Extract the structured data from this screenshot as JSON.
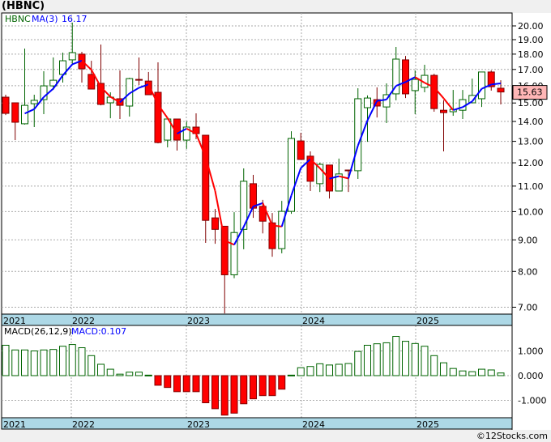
{
  "header": {
    "title": "(HBNC)"
  },
  "footer": {
    "copyright": "©12Stocks.com"
  },
  "colors": {
    "up": "#006400",
    "down": "#ff0000",
    "down_border": "#800000",
    "ma_up": "#0000ff",
    "ma_down": "#ff0000",
    "axis_band": "#add8e6",
    "last_price_bg": "#ffb6b6"
  },
  "chart_data": [
    {
      "type": "candlestick",
      "symbol_label": "HBNC",
      "indicator_label": "MA(3)",
      "indicator_value": "16.17",
      "last_price": "15.63",
      "scale": "log",
      "ylim": [
        6.8,
        20.6
      ],
      "y_ticks": [
        "20.00",
        "19.00",
        "18.00",
        "17.00",
        "16.00",
        "15.00",
        "14.00",
        "13.00",
        "12.00",
        "11.00",
        "10.00",
        "9.00",
        "8.00",
        "7.00"
      ],
      "x_ticks": [
        "2021",
        "2022",
        "2023",
        "2024",
        "2025"
      ],
      "grid": true,
      "period": "monthly",
      "ohlc": [
        [
          15.33,
          15.47,
          14.34,
          14.43
        ],
        [
          15.01,
          15.01,
          13.06,
          13.96
        ],
        [
          13.88,
          18.38,
          13.84,
          14.87
        ],
        [
          14.96,
          15.47,
          13.71,
          15.15
        ],
        [
          15.19,
          16.89,
          14.39,
          15.99
        ],
        [
          15.99,
          17.78,
          15.75,
          16.33
        ],
        [
          16.69,
          18.1,
          16.19,
          17.56
        ],
        [
          17.62,
          20.25,
          17.3,
          18.1
        ],
        [
          18.0,
          18.16,
          16.19,
          17.04
        ],
        [
          16.69,
          17.56,
          15.8,
          15.8
        ],
        [
          16.14,
          18.66,
          14.87,
          14.92
        ],
        [
          15.01,
          15.61,
          14.17,
          15.33
        ],
        [
          15.24,
          16.94,
          14.13,
          14.87
        ],
        [
          14.83,
          16.48,
          14.26,
          16.43
        ],
        [
          16.38,
          17.78,
          16.04,
          16.33
        ],
        [
          16.28,
          16.84,
          15.47,
          15.47
        ],
        [
          15.61,
          17.46,
          12.9,
          12.94
        ],
        [
          13.06,
          14.13,
          12.71,
          14.13
        ],
        [
          14.13,
          14.13,
          12.56,
          13.06
        ],
        [
          13.06,
          14.0,
          12.64,
          13.71
        ],
        [
          13.71,
          14.43,
          13.1,
          13.38
        ],
        [
          13.3,
          13.3,
          8.9,
          9.68
        ],
        [
          9.77,
          10.1,
          8.87,
          9.36
        ],
        [
          9.47,
          9.47,
          6.84,
          7.9
        ],
        [
          7.9,
          9.98,
          7.8,
          9.25
        ],
        [
          9.36,
          11.75,
          8.69,
          11.2
        ],
        [
          11.1,
          11.47,
          9.77,
          10.13
        ],
        [
          10.2,
          10.45,
          9.22,
          9.65
        ],
        [
          9.59,
          9.95,
          8.45,
          8.71
        ],
        [
          8.71,
          10.41,
          8.56,
          10.01
        ],
        [
          10.01,
          13.5,
          9.92,
          13.14
        ],
        [
          13.02,
          13.42,
          12.15,
          12.15
        ],
        [
          12.3,
          12.52,
          10.8,
          11.2
        ],
        [
          11.1,
          12.0,
          10.76,
          11.93
        ],
        [
          11.9,
          11.9,
          10.5,
          10.8
        ],
        [
          10.8,
          12.19,
          10.8,
          11.51
        ],
        [
          11.68,
          11.68,
          10.76,
          11.65
        ],
        [
          11.65,
          15.85,
          11.3,
          15.24
        ],
        [
          14.74,
          15.43,
          12.98,
          15.28
        ],
        [
          15.19,
          15.9,
          14.21,
          14.83
        ],
        [
          14.78,
          16.14,
          13.92,
          15.47
        ],
        [
          15.52,
          18.49,
          15.15,
          17.67
        ],
        [
          17.62,
          17.88,
          15.28,
          15.52
        ],
        [
          15.71,
          16.94,
          14.39,
          16.38
        ],
        [
          15.9,
          17.3,
          15.61,
          16.63
        ],
        [
          16.63,
          16.73,
          14.52,
          14.69
        ],
        [
          14.6,
          15.15,
          12.52,
          14.47
        ],
        [
          14.52,
          15.75,
          14.3,
          14.65
        ],
        [
          14.6,
          15.75,
          14.13,
          15.19
        ],
        [
          15.01,
          16.43,
          15.01,
          15.43
        ],
        [
          15.24,
          16.84,
          14.78,
          16.84
        ],
        [
          16.84,
          16.94,
          15.71,
          15.94
        ],
        [
          15.85,
          16.33,
          14.92,
          15.63
        ]
      ]
    },
    {
      "type": "bar",
      "indicator_label": "MACD(26,12,9)",
      "value_label": "MACD:0.107",
      "y_ticks": [
        "1.000",
        "0.000",
        "-1.000"
      ],
      "x_ticks": [
        "2021",
        "2022",
        "2023",
        "2024",
        "2025"
      ],
      "ylim": [
        -1.65,
        1.95
      ],
      "values": [
        1.23,
        1.04,
        1.04,
        1.0,
        1.04,
        1.06,
        1.19,
        1.26,
        1.13,
        0.81,
        0.46,
        0.26,
        0.06,
        0.14,
        0.14,
        0.02,
        -0.39,
        -0.48,
        -0.65,
        -0.65,
        -0.65,
        -1.1,
        -1.34,
        -1.6,
        -1.52,
        -1.14,
        -0.94,
        -0.81,
        -0.81,
        -0.55,
        0.02,
        0.32,
        0.37,
        0.48,
        0.43,
        0.46,
        0.49,
        0.98,
        1.23,
        1.29,
        1.33,
        1.59,
        1.39,
        1.3,
        1.19,
        0.81,
        0.52,
        0.29,
        0.19,
        0.16,
        0.26,
        0.23,
        0.107
      ]
    }
  ]
}
